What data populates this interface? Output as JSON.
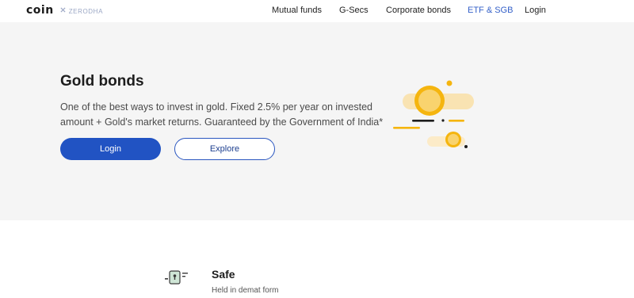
{
  "header": {
    "logo_text": "coin",
    "logo_sub": "ZERODHA",
    "nav": [
      {
        "label": "Mutual funds",
        "active": false
      },
      {
        "label": "G-Secs",
        "active": false
      },
      {
        "label": "Corporate bonds",
        "active": false
      },
      {
        "label": "ETF & SGB",
        "active": true
      },
      {
        "label": "Login",
        "active": false
      }
    ]
  },
  "hero": {
    "title": "Gold bonds",
    "description": "One of the best ways to invest in gold. Fixed 2.5% per year on invested amount + Gold's market returns. Guaranteed by the Government of India*",
    "login_label": "Login",
    "explore_label": "Explore",
    "illustration_icon": "gold-coins-icon"
  },
  "features": {
    "safe": {
      "icon": "safe-vault-icon",
      "title": "Safe",
      "description": "Held in demat form"
    }
  },
  "colors": {
    "accent": "#2153c3",
    "active_nav": "#3561c9",
    "gold": "#f5b50f",
    "hero_bg": "#f5f5f5"
  }
}
